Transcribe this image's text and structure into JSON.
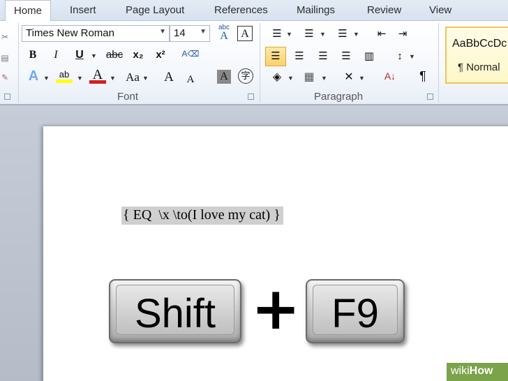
{
  "tabs": [
    "Home",
    "Insert",
    "Page Layout",
    "References",
    "Mailings",
    "Review",
    "View"
  ],
  "font_group": {
    "font_name": "Times New Roman",
    "font_size": "14",
    "label": "Font",
    "bold": "B",
    "italic": "I",
    "underline": "U",
    "strikethrough": "abc",
    "subscript": "x₂",
    "superscript": "x²",
    "grow": "A",
    "shrink": "A",
    "change_case": "Aa",
    "font_color": "A",
    "highlight": "ab",
    "text_effects": "A",
    "char_shading": "A",
    "enclose": "字",
    "phonetic": "abc",
    "clear": "A"
  },
  "paragraph_group": {
    "label": "Paragraph",
    "sort": "A↓",
    "pilcrow": "¶"
  },
  "styles": {
    "sample": "AaBbCcDc",
    "name": "¶ Normal"
  },
  "document": {
    "field_code": "{ EQ  \\x \\to(I love my cat) }"
  },
  "keys": {
    "shift": "Shift",
    "plus": "+",
    "f9": "F9"
  },
  "watermark": {
    "prefix": "wiki",
    "suffix": "How"
  },
  "colors": {
    "accent_highlight": "#f3c15a",
    "font_color_bar": "#d32020",
    "highlight_bar": "#ffff00",
    "watermark_bg": "#7aa34a"
  }
}
